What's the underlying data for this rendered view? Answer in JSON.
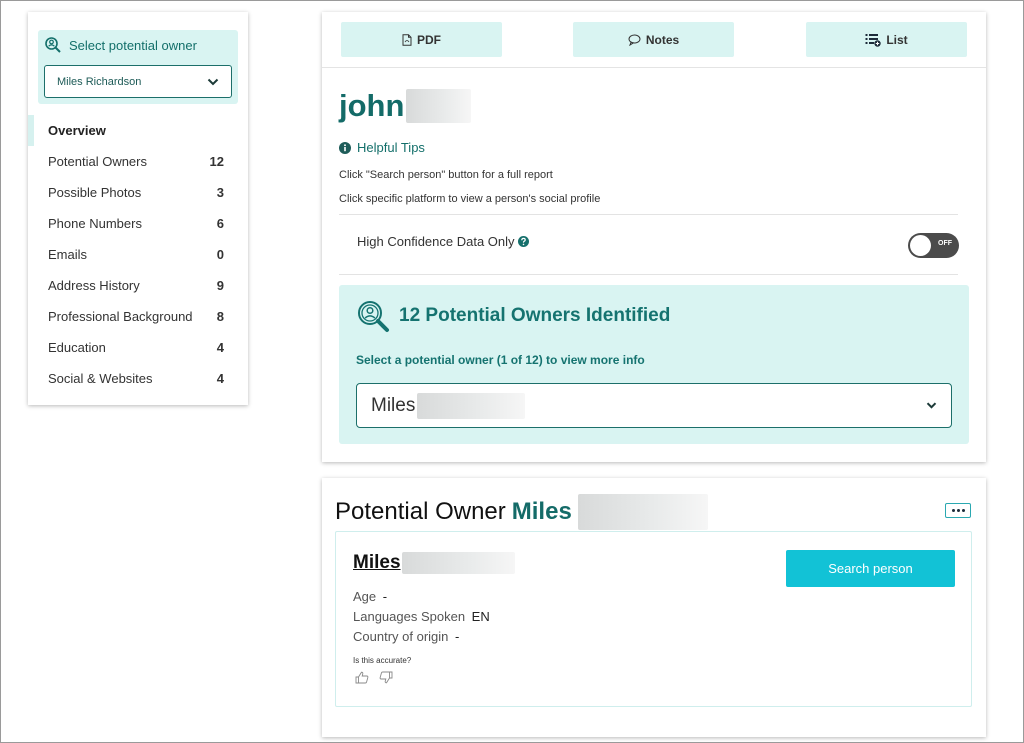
{
  "sidebar": {
    "select_label": "Select potential owner",
    "selected_owner": "Miles Richardson",
    "items": [
      {
        "label": "Overview",
        "count": ""
      },
      {
        "label": "Potential Owners",
        "count": "12"
      },
      {
        "label": "Possible Photos",
        "count": "3"
      },
      {
        "label": "Phone Numbers",
        "count": "6"
      },
      {
        "label": "Emails",
        "count": "0"
      },
      {
        "label": "Address History",
        "count": "9"
      },
      {
        "label": "Professional Background",
        "count": "8"
      },
      {
        "label": "Education",
        "count": "4"
      },
      {
        "label": "Social & Websites",
        "count": "4"
      }
    ]
  },
  "toolbar": {
    "pdf_label": "PDF",
    "notes_label": "Notes",
    "list_label": "List"
  },
  "main": {
    "person_name": "john",
    "tips_title": "Helpful Tips",
    "tip_1": "Click \"Search person\" button for a full report",
    "tip_2": "Click specific platform to view a person's social profile",
    "confidence_label": "High Confidence Data Only",
    "toggle_label": "OFF",
    "owners_title": "12 Potential Owners Identified",
    "owners_sub": "Select a potential owner (1 of 12) to view more info",
    "owners_selected": "Miles"
  },
  "owner_card": {
    "heading_prefix": "Potential Owner",
    "heading_name": "Miles",
    "name": "Miles",
    "search_label": "Search person",
    "age_label": "Age",
    "age_value": "-",
    "languages_label": "Languages Spoken",
    "languages_value": "EN",
    "country_label": "Country of origin",
    "country_value": "-",
    "accurate_question": "Is this accurate?"
  },
  "colors": {
    "accent": "#146b68",
    "panel_bg": "#d9f4f2",
    "search_button": "#12c2d6",
    "toggle_off": "#4b4b4b"
  },
  "icons": [
    "search-person-icon",
    "chevron-down-icon",
    "pdf-icon",
    "notes-icon",
    "list-icon",
    "info-icon",
    "help-icon",
    "thumbs-up-icon",
    "thumbs-down-icon",
    "more-icon"
  ]
}
